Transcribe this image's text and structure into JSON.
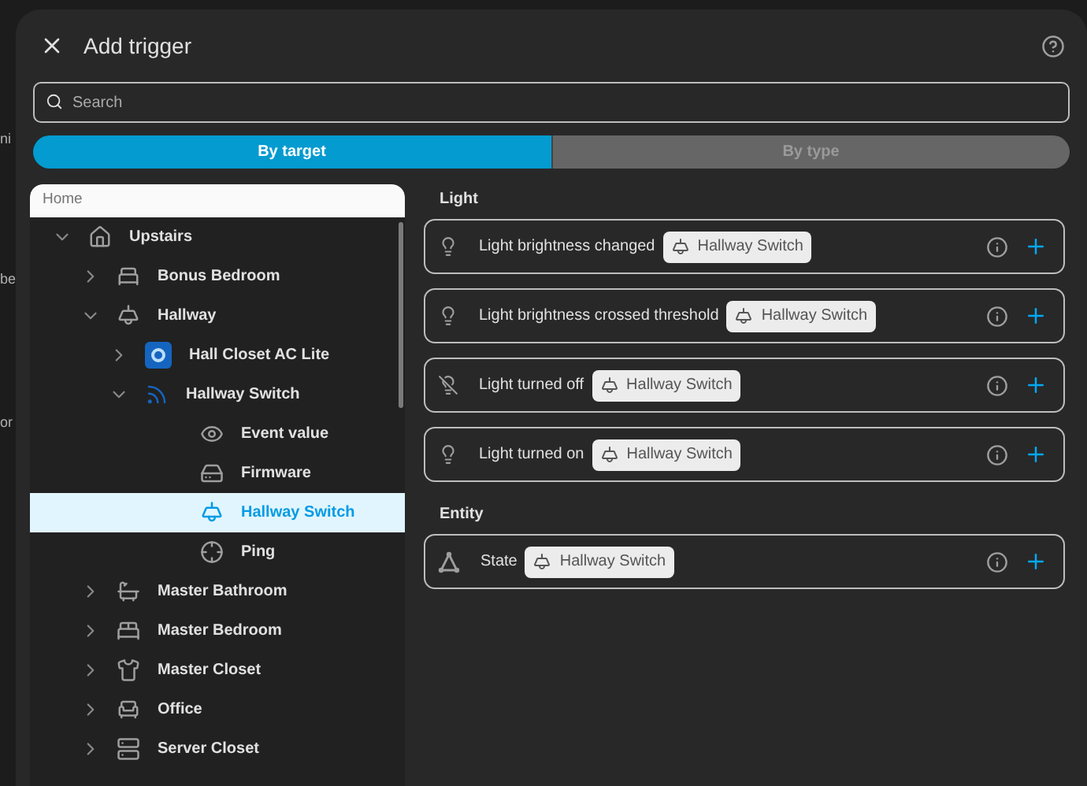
{
  "background_fragments": [
    "ni",
    "be",
    "or"
  ],
  "dialog": {
    "title": "Add trigger"
  },
  "search": {
    "placeholder": "Search"
  },
  "toggle": [
    {
      "label": "By target",
      "selected": true
    },
    {
      "label": "By type",
      "selected": false
    }
  ],
  "tree": {
    "header": "Home",
    "items": [
      {
        "label": "Upstairs",
        "expanded": true,
        "selected": false,
        "children": [
          {
            "label": "Bonus Bedroom",
            "expanded": false,
            "selected": false
          },
          {
            "label": "Hallway",
            "expanded": true,
            "selected": false,
            "children": [
              {
                "label": "Hall Closet AC Lite",
                "expanded": false,
                "selected": false
              },
              {
                "label": "Hallway Switch",
                "expanded": true,
                "selected": false,
                "children": [
                  {
                    "label": "Event value",
                    "selected": false
                  },
                  {
                    "label": "Firmware",
                    "selected": false
                  },
                  {
                    "label": "Hallway Switch",
                    "selected": true
                  },
                  {
                    "label": "Ping",
                    "selected": false
                  }
                ]
              }
            ]
          },
          {
            "label": "Master Bathroom",
            "expanded": false,
            "selected": false
          },
          {
            "label": "Master Bedroom",
            "expanded": false,
            "selected": false
          },
          {
            "label": "Master Closet",
            "expanded": false,
            "selected": false
          },
          {
            "label": "Office",
            "expanded": false,
            "selected": false
          },
          {
            "label": "Server Closet",
            "expanded": false,
            "selected": false
          }
        ]
      }
    ]
  },
  "sections": [
    {
      "title": "Light",
      "triggers": [
        {
          "kind": "light",
          "label": "Light brightness changed",
          "target": "Hallway Switch"
        },
        {
          "kind": "light",
          "label": "Light brightness crossed threshold",
          "target": "Hallway Switch"
        },
        {
          "kind": "light-off",
          "label": "Light turned off",
          "target": "Hallway Switch"
        },
        {
          "kind": "light",
          "label": "Light turned on",
          "target": "Hallway Switch"
        }
      ]
    },
    {
      "title": "Entity",
      "triggers": [
        {
          "kind": "state",
          "label": "State",
          "target": "Hallway Switch"
        }
      ]
    }
  ]
}
